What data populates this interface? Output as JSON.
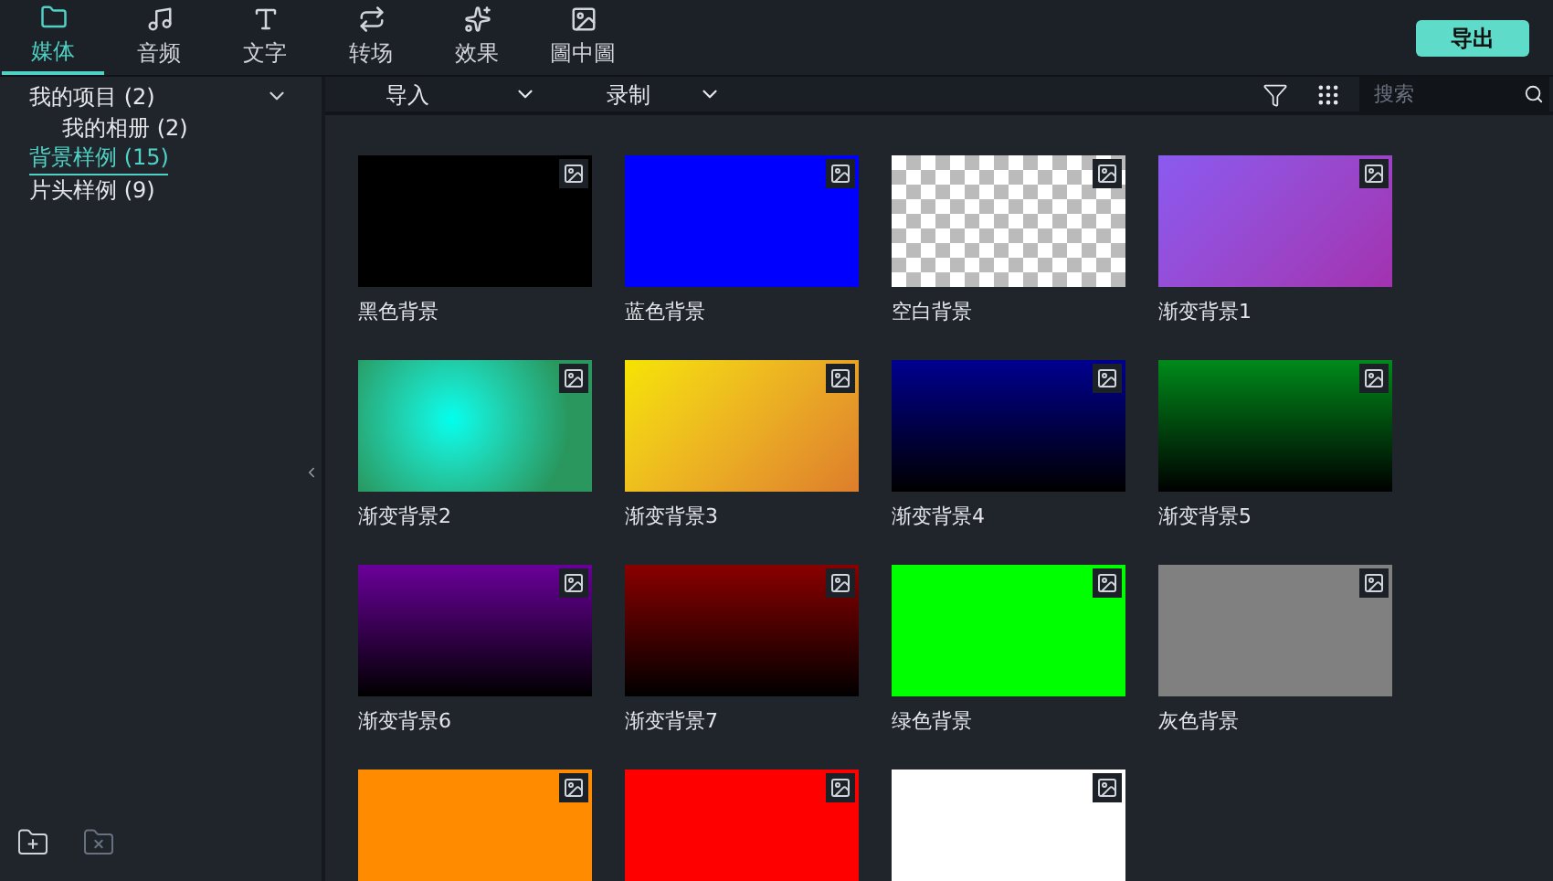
{
  "tabs": [
    {
      "label": "媒体",
      "selected": true
    },
    {
      "label": "音频",
      "selected": false
    },
    {
      "label": "文字",
      "selected": false
    },
    {
      "label": "转场",
      "selected": false
    },
    {
      "label": "效果",
      "selected": false
    },
    {
      "label": "圖中圖",
      "selected": false
    }
  ],
  "export_button": "导出",
  "sidebar": {
    "items": [
      {
        "label": "我的项目",
        "count": "(2)",
        "selected": false,
        "expanded": true,
        "children": [
          {
            "label": "我的相册",
            "count": "(2)",
            "selected": false
          }
        ]
      },
      {
        "label": "背景样例",
        "count": "(15)",
        "selected": true
      },
      {
        "label": "片头样例",
        "count": "(9)",
        "selected": false
      }
    ]
  },
  "toolbar": {
    "dropdowns": [
      "导入",
      "录制"
    ],
    "search": {
      "placeholder": "搜索"
    }
  },
  "media": [
    {
      "label": "黑色背景",
      "kind": "solid",
      "color": "#000000"
    },
    {
      "label": "蓝色背景",
      "kind": "solid",
      "color": "#0000ff"
    },
    {
      "label": "空白背景",
      "kind": "checker",
      "color": "#ffffff"
    },
    {
      "label": "渐变背景1",
      "kind": "linear",
      "color": "#8a5af0"
    },
    {
      "label": "渐变背景2",
      "kind": "radial",
      "color": "#00ffee"
    },
    {
      "label": "渐变背景3",
      "kind": "linear",
      "color": "#f5e400"
    },
    {
      "label": "渐变背景4",
      "kind": "vertical",
      "color": "#000090"
    },
    {
      "label": "渐变背景5",
      "kind": "vertical",
      "color": "#008a1a"
    },
    {
      "label": "渐变背景6",
      "kind": "vertical",
      "color": "#6a009a"
    },
    {
      "label": "渐变背景7",
      "kind": "vertical",
      "color": "#8a0000"
    },
    {
      "label": "绿色背景",
      "kind": "solid",
      "color": "#00ff00"
    },
    {
      "label": "灰色背景",
      "kind": "solid",
      "color": "#808080"
    },
    {
      "kind": "solid",
      "color": "#ff8c00"
    },
    {
      "kind": "solid",
      "color": "#ff0000"
    },
    {
      "kind": "solid",
      "color": "#ffffff"
    }
  ]
}
